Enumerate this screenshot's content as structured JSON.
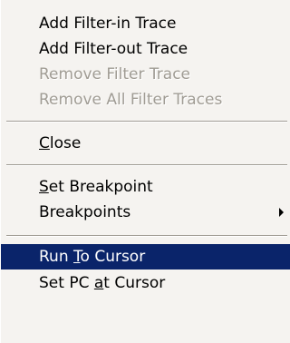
{
  "menu": {
    "items": [
      {
        "label": "Add Filter-in Trace",
        "enabled": true
      },
      {
        "label": "Add Filter-out Trace",
        "enabled": true
      },
      {
        "label": "Remove Filter Trace",
        "enabled": false
      },
      {
        "label": "Remove All Filter Traces",
        "enabled": false
      },
      {
        "mnemonic": "C",
        "rest": "lose",
        "enabled": true
      },
      {
        "mnemonic": "S",
        "rest": "et Breakpoint",
        "enabled": true
      },
      {
        "label": "Breakpoints",
        "enabled": true,
        "submenu": true
      },
      {
        "prefix": "Run ",
        "mnemonic": "T",
        "rest": "o Cursor",
        "enabled": true,
        "highlighted": true
      },
      {
        "prefix": "Set PC ",
        "mnemonic": "a",
        "rest": "t Cursor",
        "enabled": true
      }
    ]
  },
  "colors": {
    "menu_background": "#f5f3f0",
    "highlight_background": "#0a246a",
    "highlight_text": "#ffffff",
    "disabled_text": "#a09c94"
  },
  "icons": {
    "submenu_arrow": "chevron-right-icon"
  }
}
